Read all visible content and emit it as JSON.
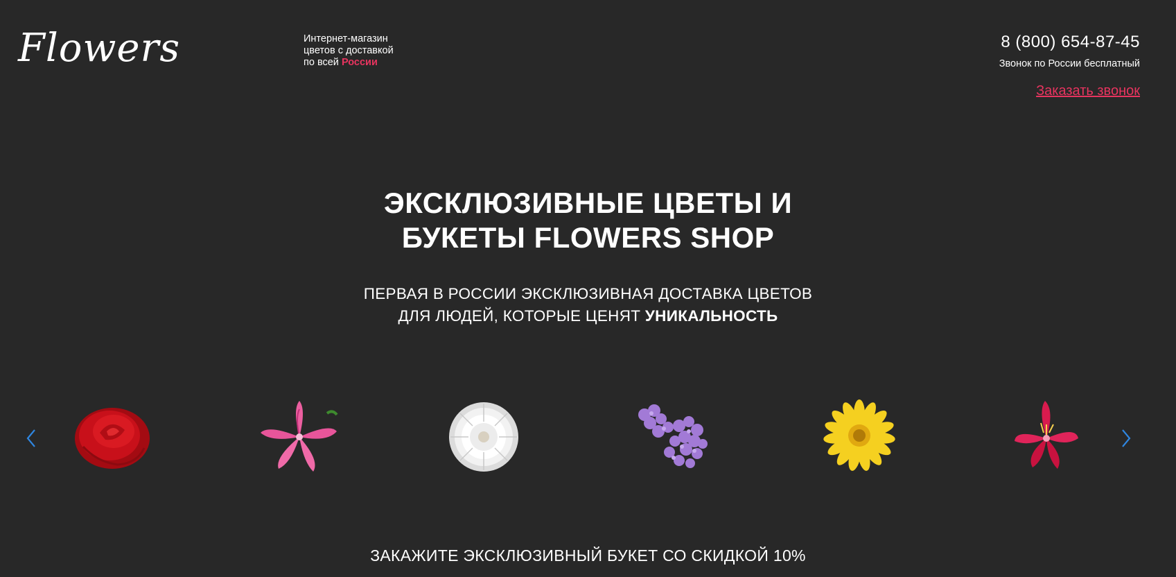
{
  "header": {
    "logo": "Flowers",
    "tagline_line1": "Интернет-магазин",
    "tagline_line2": "цветов с доставкой",
    "tagline_line3_prefix": "по всей",
    "tagline_line3_accent": "России",
    "phone": "8 (800) 654-87-45",
    "phone_note": "Звонок по России бесплатный",
    "callback_link": "Заказать звонок"
  },
  "hero": {
    "title_line1": "ЭКСКЛЮЗИВНЫЕ ЦВЕТЫ И",
    "title_line2": "БУКЕТЫ FLOWERS SHOP",
    "subtitle_line1": "ПЕРВАЯ В РОССИИ ЭКСКЛЮЗИВНАЯ ДОСТАВКА ЦВЕТОВ",
    "subtitle_line2_prefix": "ДЛЯ ЛЮДЕЙ, КОТОРЫЕ ЦЕНЯТ",
    "subtitle_line2_bold": "УНИКАЛЬНОСТЬ"
  },
  "carousel": {
    "prev_icon": "chevron-left-icon",
    "next_icon": "chevron-right-icon",
    "items": [
      {
        "icon": "red-rose-icon",
        "color": "#c8101a"
      },
      {
        "icon": "pink-lily-icon",
        "color": "#e8559a"
      },
      {
        "icon": "white-dahlia-icon",
        "color": "#f2f2f2"
      },
      {
        "icon": "lilac-icon",
        "color": "#a27ad6"
      },
      {
        "icon": "yellow-gerbera-icon",
        "color": "#f5d020"
      },
      {
        "icon": "alstroemeria-icon",
        "color": "#d81b4e"
      }
    ]
  },
  "promo": {
    "text": "ЗАКАЖИТЕ ЭКСКЛЮЗИВНЫЙ БУКЕТ СО СКИДКОЙ 10%"
  },
  "colors": {
    "background": "#282828",
    "accent": "#e8345f",
    "arrow": "#2f86e0",
    "text": "#ffffff"
  }
}
